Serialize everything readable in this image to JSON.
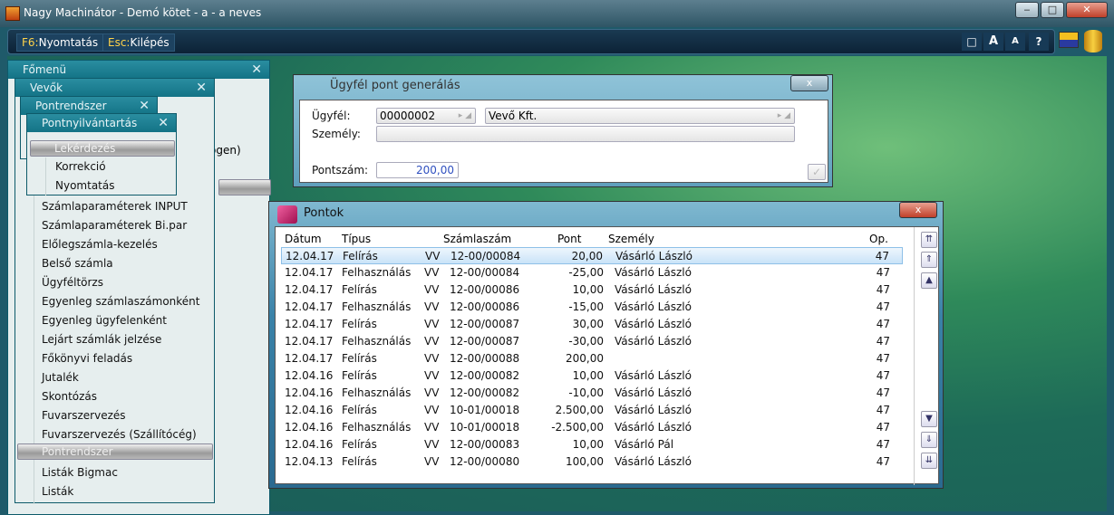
{
  "window": {
    "title": "Nagy Machinátor - Demó kötet - a - a neves",
    "min": "‒",
    "max": "□",
    "close": "✕"
  },
  "toolbar": {
    "print_key": "F6:",
    "print_label": "Nyomtatás",
    "exit_key": "Esc:",
    "exit_label": "Kilépés",
    "icons": [
      "□",
      "A",
      "A",
      "?"
    ]
  },
  "menus": {
    "fomenu": {
      "title": "Főmenü",
      "partial_text": "ogen)"
    },
    "vevok": {
      "title": "Vevők",
      "items": [
        "Számlaparaméterek INPUT",
        "Számlaparaméterek Bi.par",
        "Előlegszámla-kezelés",
        "Belső számla",
        "Ügyféltörzs",
        "Egyenleg számlaszámonként",
        "Egyenleg ügyfelenként",
        "Lejárt számlák jelzése",
        "Főkönyvi feladás",
        "Jutalék",
        "Skontózás",
        "Fuvarszervezés",
        "Fuvarszervezés (Szállítócég)"
      ],
      "separator": "Pontrendszer",
      "items2": [
        "Listák Bigmac",
        "Listák"
      ]
    },
    "pontrendszer": {
      "title": "Pontrendszer"
    },
    "pontnyilvantartas": {
      "title": "Pontnyilvántartás",
      "separator": "Lekérdezés",
      "items": [
        "Korrekció",
        "Nyomtatás"
      ]
    }
  },
  "dialog": {
    "title": "Ügyfél pont generálás",
    "ugyfel_label": "Ügyfél:",
    "ugyfel_code": "00000002",
    "ugyfel_name": "Vevő Kft.",
    "szemely_label": "Személy:",
    "szemely_value": "",
    "pontszam_label": "Pontszám:",
    "pontszam_value": "200,00",
    "ok": "✓",
    "close": "x"
  },
  "pontok": {
    "title": "Pontok",
    "close": "x",
    "columns": [
      "Dátum",
      "Típus",
      "Számlaszám",
      "Pont",
      "Személy",
      "Op."
    ],
    "rows": [
      [
        "12.04.17",
        "Felírás",
        "VV",
        "12-00/00084",
        "20,00",
        "Vásárló László",
        "47"
      ],
      [
        "12.04.17",
        "Felhasználás",
        "VV",
        "12-00/00084",
        "-25,00",
        "Vásárló László",
        "47"
      ],
      [
        "12.04.17",
        "Felírás",
        "VV",
        "12-00/00086",
        "10,00",
        "Vásárló László",
        "47"
      ],
      [
        "12.04.17",
        "Felhasználás",
        "VV",
        "12-00/00086",
        "-15,00",
        "Vásárló László",
        "47"
      ],
      [
        "12.04.17",
        "Felírás",
        "VV",
        "12-00/00087",
        "30,00",
        "Vásárló László",
        "47"
      ],
      [
        "12.04.17",
        "Felhasználás",
        "VV",
        "12-00/00087",
        "-30,00",
        "Vásárló László",
        "47"
      ],
      [
        "12.04.17",
        "Felírás",
        "VV",
        "12-00/00088",
        "200,00",
        "",
        "47"
      ],
      [
        "12.04.16",
        "Felírás",
        "VV",
        "12-00/00082",
        "10,00",
        "Vásárló László",
        "47"
      ],
      [
        "12.04.16",
        "Felhasználás",
        "VV",
        "12-00/00082",
        "-10,00",
        "Vásárló László",
        "47"
      ],
      [
        "12.04.16",
        "Felírás",
        "VV",
        "10-01/00018",
        "2.500,00",
        "Vásárló László",
        "47"
      ],
      [
        "12.04.16",
        "Felhasználás",
        "VV",
        "10-01/00018",
        "-2.500,00",
        "Vásárló László",
        "47"
      ],
      [
        "12.04.16",
        "Felírás",
        "VV",
        "12-00/00083",
        "10,00",
        "Vásárló Pál",
        "47"
      ],
      [
        "12.04.13",
        "Felírás",
        "VV",
        "12-00/00080",
        "100,00",
        "Vásárló László",
        "47"
      ]
    ],
    "scroll": [
      "⇈",
      "⇑",
      "▲",
      "▼",
      "⇓",
      "⇊"
    ]
  }
}
